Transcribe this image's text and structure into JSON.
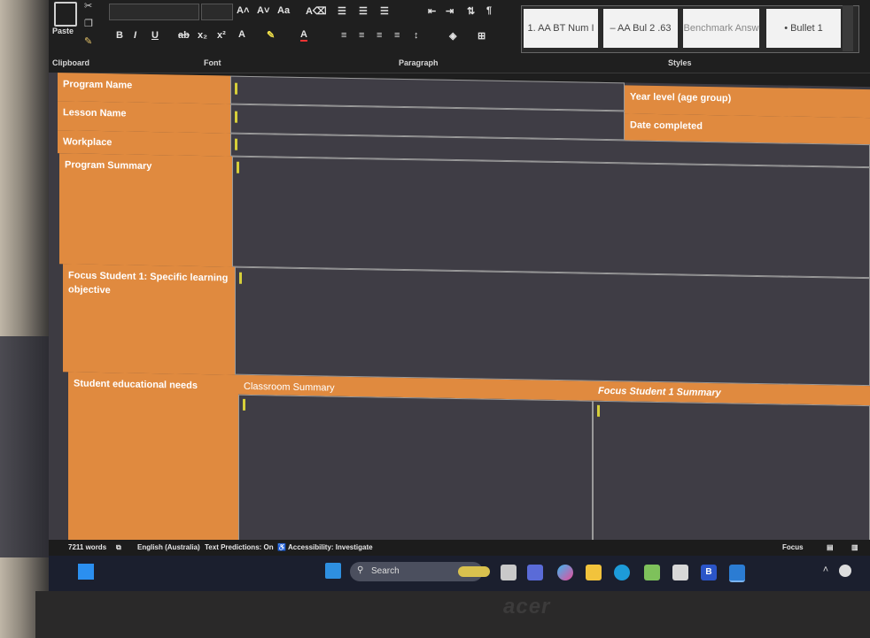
{
  "ribbon": {
    "clipboard_label": "Clipboard",
    "paste_label": "Paste",
    "font_label": "Font",
    "paragraph_label": "Paragraph",
    "styles_label": "Styles",
    "font_tools": [
      "B",
      "I",
      "U",
      "ab",
      "x₂",
      "x²"
    ],
    "styles": [
      "1. AA BT Num I",
      "– AA Bul 2 .63",
      "Benchmark Answ",
      "• Bullet 1"
    ]
  },
  "table": {
    "program_name": "Program Name",
    "year_level": "Year level (age group)",
    "lesson_name": "Lesson Name",
    "date_completed": "Date completed",
    "workplace": "Workplace",
    "program_summary": "Program Summary",
    "focus_student": "Focus Student 1: Specific learning objective",
    "student_needs": "Student educational needs",
    "classroom_summary": "Classroom Summary",
    "focus_student_summary": "Focus Student 1 Summary"
  },
  "status": {
    "words": "7211 words",
    "language": "English (Australia)",
    "predictions": "Text Predictions: On",
    "accessibility": "Accessibility: Investigate",
    "focus": "Focus"
  },
  "taskbar": {
    "search_placeholder": "Search"
  },
  "brand": "acer"
}
